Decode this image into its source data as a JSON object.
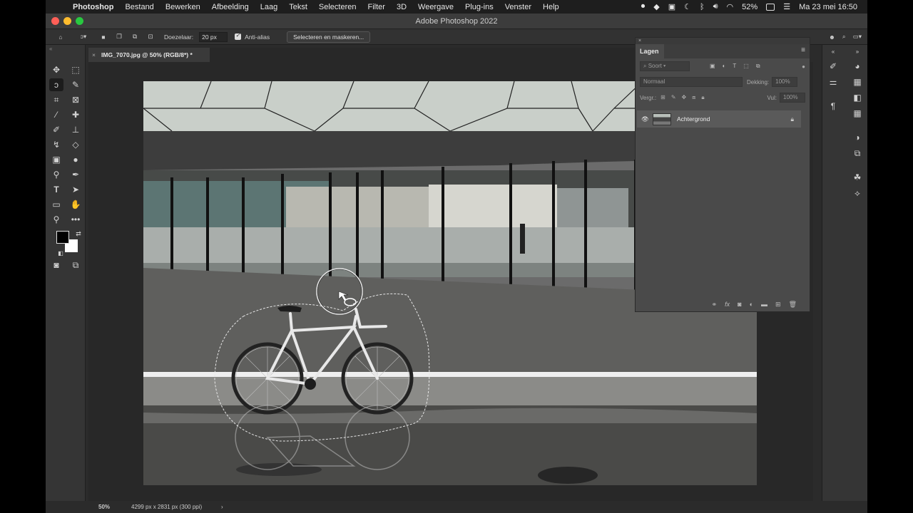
{
  "menubar": {
    "app_name": "Photoshop",
    "items": [
      "Bestand",
      "Bewerken",
      "Afbeelding",
      "Laag",
      "Tekst",
      "Selecteren",
      "Filter",
      "3D",
      "Weergave",
      "Plug-ins",
      "Venster",
      "Help"
    ],
    "battery": "52%",
    "datetime": "Ma 23 mei  16:50"
  },
  "window": {
    "title": "Adobe Photoshop 2022"
  },
  "options": {
    "feather_label": "Doezelaar:",
    "feather_value": "20 px",
    "antialias_label": "Anti-alias",
    "select_mask_label": "Selecteren en maskeren..."
  },
  "document": {
    "tab_label": "IMG_7070.jpg @ 50% (RGB/8*) *"
  },
  "layers_panel": {
    "title": "Lagen",
    "search_placeholder": "Soort",
    "blend_mode": "Normaal",
    "opacity_label": "Dekking:",
    "opacity_value": "100%",
    "lock_label": "Vergr.:",
    "fill_label": "Vul:",
    "fill_value": "100%",
    "layers": [
      {
        "name": "Achtergrond"
      }
    ]
  },
  "status": {
    "zoom": "50%",
    "doc_info": "4299 px x 2831 px (300 ppi)"
  },
  "colors": {
    "foreground": "#000000",
    "background": "#ffffff",
    "accent": "#dcdcdc"
  }
}
